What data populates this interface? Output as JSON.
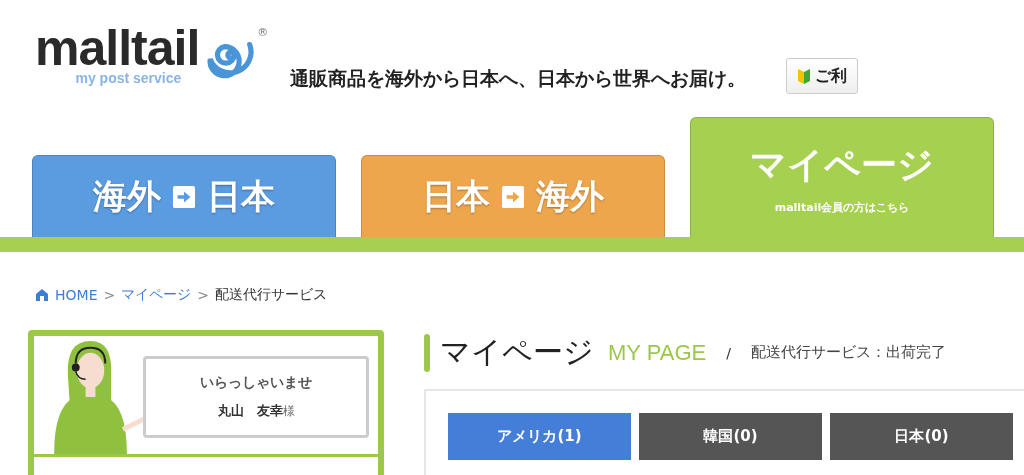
{
  "header": {
    "logo": {
      "name": "malltail",
      "tagline": "my post service",
      "mark": "®"
    },
    "slogan": "通販商品を海外から日本へ、日本から世界へお届け。",
    "guide_button": "ご利"
  },
  "tabs": [
    {
      "kind": "route",
      "from": "海外",
      "to": "日本",
      "color": "#5b9be0",
      "selected": false
    },
    {
      "kind": "route",
      "from": "日本",
      "to": "海外",
      "color": "#eda64c",
      "selected": false
    },
    {
      "kind": "member",
      "title": "マイページ",
      "subtitle": "malltail会員の方はこちら",
      "color": "#a6d04f",
      "selected": true
    }
  ],
  "breadcrumb": [
    {
      "label": "HOME",
      "link": true
    },
    {
      "separator": ">",
      "label": "マイページ",
      "link": true
    },
    {
      "separator": ">",
      "label": "配送代行サービス",
      "link": false
    }
  ],
  "sidebar": {
    "greeting": "いらっしゃいませ",
    "user_name": "丸山　友幸",
    "honorific": "様"
  },
  "page_title": {
    "title": "マイページ",
    "english": "MY PAGE",
    "separator": "/",
    "subtitle": "配送代行サービス：出荷完了"
  },
  "country_tabs": [
    {
      "label": "アメリカ(1)",
      "selected": true
    },
    {
      "label": "韓国(0)",
      "selected": false
    },
    {
      "label": "日本(0)",
      "selected": false
    }
  ]
}
